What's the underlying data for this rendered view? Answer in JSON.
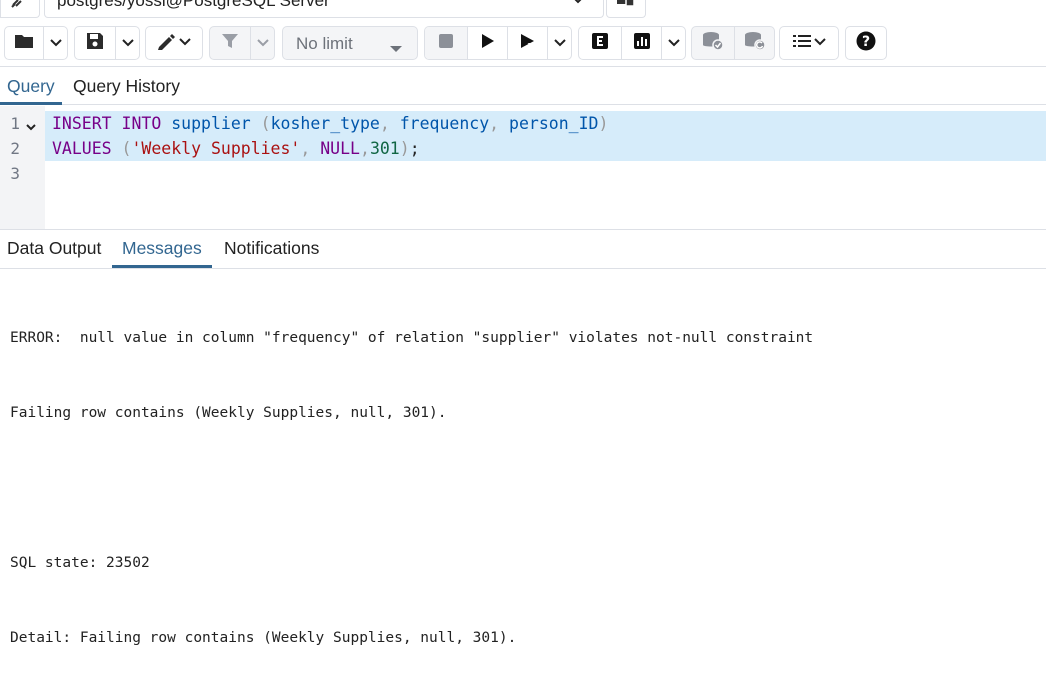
{
  "connection": {
    "label": "postgres/yossi@PostgreSQL Server"
  },
  "toolbar": {
    "limit_value": "No limit"
  },
  "query_tabs": [
    {
      "label": "Query",
      "active": true
    },
    {
      "label": "Query History",
      "active": false
    }
  ],
  "editor": {
    "line_numbers": [
      "1",
      "2",
      "3"
    ],
    "line1": {
      "kw_insert": "INSERT",
      "kw_into": "INTO",
      "table": "supplier",
      "open_paren": "(",
      "col1": "kosher_type",
      "comma1": ",",
      "col2": "frequency",
      "comma2": ",",
      "col3": "person_ID",
      "close_paren": ")"
    },
    "line2": {
      "kw_values": "VALUES",
      "open_paren": "(",
      "str1": "'Weekly Supplies'",
      "comma1": ",",
      "kw_null": "NULL",
      "comma2": ",",
      "num": "301",
      "close_paren": ")",
      "semicolon": ";"
    }
  },
  "result_tabs": [
    {
      "label": "Data Output",
      "active": false
    },
    {
      "label": "Messages",
      "active": true
    },
    {
      "label": "Notifications",
      "active": false
    }
  ],
  "messages": {
    "line1": "ERROR:  null value in column \"frequency\" of relation \"supplier\" violates not-null constraint",
    "line2": "Failing row contains (Weekly Supplies, null, 301).",
    "line3": "",
    "line4": "SQL state: 23502",
    "line5": "Detail: Failing row contains (Weekly Supplies, null, 301)."
  },
  "colors": {
    "accent": "#326690",
    "line_highlight": "#d6ecfa",
    "keyword": "#770088",
    "identifier": "#0055aa",
    "string": "#aa1111",
    "number": "#116644"
  },
  "icons": [
    "connection-icon",
    "chevron-down-icon",
    "database-stack-icon",
    "folder-icon",
    "save-icon",
    "pen-icon",
    "filter-icon",
    "stop-icon",
    "play-icon",
    "play-step-icon",
    "explain-icon",
    "explain-analyze-icon",
    "commit-icon",
    "rollback-icon",
    "list-format-icon",
    "help-icon"
  ]
}
